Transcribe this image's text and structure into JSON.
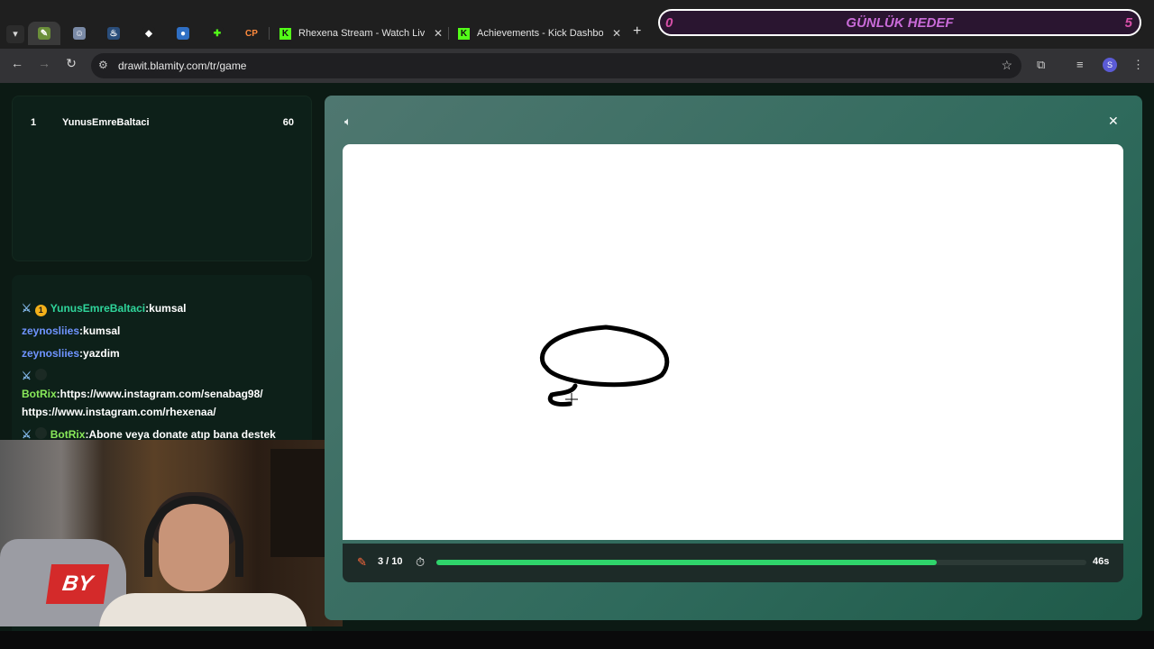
{
  "browser": {
    "tabs": [
      {
        "title": "Rhexena Stream - Watch Live o"
      },
      {
        "title": "Achievements - Kick Dashboard"
      }
    ],
    "pinned_icons": [
      "draw-icon",
      "cat-icon",
      "steam-icon",
      "diamond-icon",
      "robot-icon",
      "puzzle-icon",
      "cp-icon"
    ],
    "cp_label": "CP",
    "k_label": "K",
    "url": "drawit.blamity.com/tr/game",
    "profile_initial": "S"
  },
  "goal_overlay": {
    "current": "0",
    "title": "GÜNLÜK HEDEF",
    "target": "5"
  },
  "leaderboard": {
    "rows": [
      {
        "rank": "1",
        "name": "YunusEmreBaltaci",
        "score": "60"
      }
    ]
  },
  "chat": {
    "messages": [
      {
        "user": "YunusEmreBaltaci",
        "sep": ":",
        "text": "kumsal",
        "badge_rank": "1"
      },
      {
        "user": "zeynosliies",
        "sep": ":",
        "text": "kumsal"
      },
      {
        "user": "zeynosliies",
        "sep": ":",
        "text": "yazdim"
      },
      {
        "user": "BotRix",
        "sep": ":",
        "text": "https://www.instagram.com/senabag98/",
        "text2": "https://www.instagram.com/rhexenaa/"
      },
      {
        "user": "BotRix",
        "sep": ":",
        "text": "Abone veya donate atıp bana destek"
      }
    ]
  },
  "webcam": {
    "logo_text": "BY"
  },
  "game": {
    "round": "3 / 10",
    "time_left": "46s",
    "time_progress": 0.77
  },
  "colors": {
    "accent_green": "#2fd46b",
    "kick_green": "#53fc18",
    "goal_pink": "#d64fa8"
  }
}
